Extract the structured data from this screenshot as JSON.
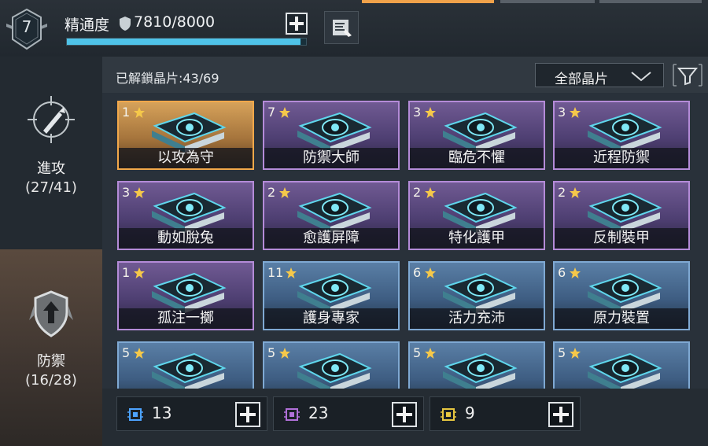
{
  "header": {
    "level": "7",
    "mastery_label": "精通度",
    "mastery_value": "7810/8000",
    "mastery_progress": 0.976,
    "plus_icon": "plus-icon",
    "doc_icon": "document-icon"
  },
  "sidebar": {
    "items": [
      {
        "label": "進攻",
        "count": "(27/41)",
        "icon": "crosshair-bullet-icon",
        "selected": false
      },
      {
        "label": "防禦",
        "count": "(16/28)",
        "icon": "shield-arrow-icon",
        "selected": true
      }
    ]
  },
  "panel": {
    "unlocked_text": "已解鎖晶片:43/69",
    "filter_label": "全部晶片",
    "filter_icon": "funnel-icon"
  },
  "cards": [
    {
      "num": "1",
      "name": "以攻為守",
      "tier": "gold",
      "icon": "fist-shield-icon"
    },
    {
      "num": "7",
      "name": "防禦大師",
      "tier": "purple",
      "icon": "crab-icon"
    },
    {
      "num": "3",
      "name": "臨危不懼",
      "tier": "purple",
      "icon": "burst-icon"
    },
    {
      "num": "3",
      "name": "近程防禦",
      "tier": "purple",
      "icon": "melee-icon"
    },
    {
      "num": "3",
      "name": "動如脫兔",
      "tier": "purple",
      "icon": "dash-icon"
    },
    {
      "num": "2",
      "name": "愈護屏障",
      "tier": "purple",
      "icon": "barrier-icon"
    },
    {
      "num": "2",
      "name": "特化護甲",
      "tier": "purple",
      "icon": "eye-armor-icon"
    },
    {
      "num": "2",
      "name": "反制裝甲",
      "tier": "purple",
      "icon": "counter-armor-icon"
    },
    {
      "num": "1",
      "name": "孤注一擲",
      "tier": "purple",
      "icon": "robot-icon"
    },
    {
      "num": "11",
      "name": "護身專家",
      "tier": "blue",
      "icon": "heart-shield-icon"
    },
    {
      "num": "6",
      "name": "活力充沛",
      "tier": "blue",
      "icon": "vitality-icon"
    },
    {
      "num": "6",
      "name": "原力裝置",
      "tier": "blue",
      "icon": "force-device-icon"
    },
    {
      "num": "5",
      "name": "",
      "tier": "blue",
      "icon": "boot-icon"
    },
    {
      "num": "5",
      "name": "",
      "tier": "blue",
      "icon": "gear-bug-icon"
    },
    {
      "num": "5",
      "name": "",
      "tier": "blue",
      "icon": "heart-icon"
    },
    {
      "num": "5",
      "name": "",
      "tier": "blue",
      "icon": "heart-wing-icon"
    }
  ],
  "resources": [
    {
      "count": "13",
      "color": "#4da3ff",
      "icon": "blue-chip-icon"
    },
    {
      "count": "23",
      "color": "#b070d8",
      "icon": "purple-chip-icon"
    },
    {
      "count": "9",
      "color": "#e6c640",
      "icon": "gold-chip-icon"
    }
  ],
  "colors": {
    "accent_cyan": "#4fc3e8",
    "gold_border": "#f2a84a",
    "star": "#f5c84a"
  }
}
